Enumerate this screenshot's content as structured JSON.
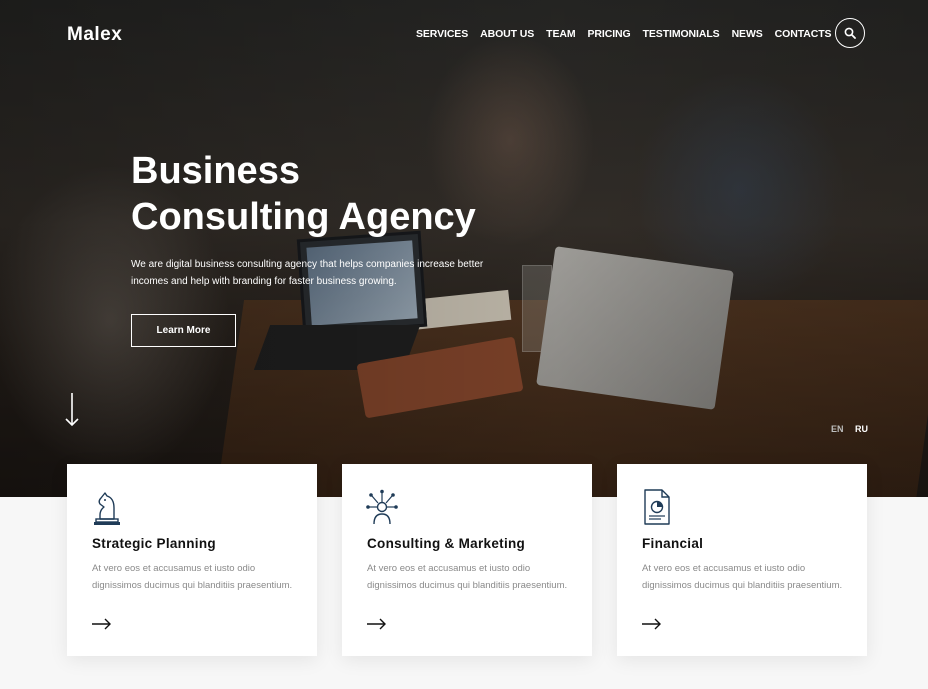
{
  "brand": {
    "logo": "Malex"
  },
  "nav": {
    "items": [
      "SERVICES",
      "ABOUT US",
      "TEAM",
      "PRICING",
      "TESTIMONIALS",
      "NEWS",
      "CONTACTS"
    ]
  },
  "hero": {
    "title_line1": "Business",
    "title_line2": "Consulting Agency",
    "subtitle": "We are digital business consulting agency that helps companies increase better incomes and help with branding for faster business growing.",
    "cta_label": "Learn More"
  },
  "languages": {
    "en": "EN",
    "ru": "RU",
    "active": "RU"
  },
  "cards": [
    {
      "title": "Strategic Planning",
      "text": "At vero eos et accusamus et iusto odio dignissimos ducimus qui blanditiis praesentium.",
      "icon": "chess-knight-icon"
    },
    {
      "title": "Consulting & Marketing",
      "text": "At vero eos et accusamus et iusto odio dignissimos ducimus qui blanditiis praesentium.",
      "icon": "consultant-network-icon"
    },
    {
      "title": "Financial",
      "text": "At vero eos et accusamus et iusto odio dignissimos ducimus qui blanditiis praesentium.",
      "icon": "financial-report-icon"
    }
  ],
  "colors": {
    "accent": "#1f3b57",
    "card_bg": "#ffffff",
    "text_muted": "#8a8a8a"
  }
}
